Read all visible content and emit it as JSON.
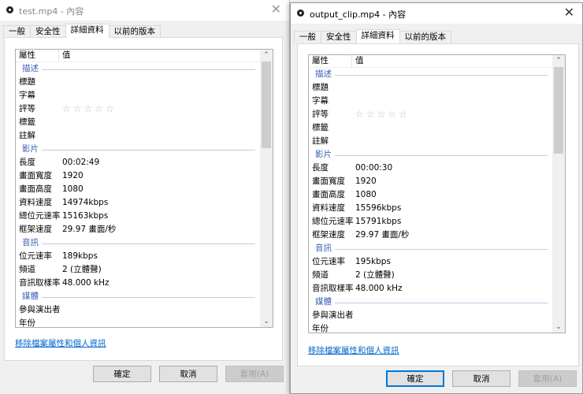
{
  "dialogs": [
    {
      "title": "test.mp4 - 內容",
      "tabs": [
        "一般",
        "安全性",
        "詳細資料",
        "以前的版本"
      ],
      "active_tab": 2,
      "header": {
        "property": "屬性",
        "value": "值"
      },
      "rows": [
        {
          "group": "描述"
        },
        {
          "k": "標題",
          "v": ""
        },
        {
          "k": "字幕",
          "v": ""
        },
        {
          "k": "評等",
          "stars": "☆☆☆☆☆"
        },
        {
          "k": "標籤",
          "v": ""
        },
        {
          "k": "註解",
          "v": ""
        },
        {
          "group": "影片"
        },
        {
          "k": "長度",
          "v": "00:02:49"
        },
        {
          "k": "畫面寬度",
          "v": "1920"
        },
        {
          "k": "畫面高度",
          "v": "1080"
        },
        {
          "k": "資料速度",
          "v": "14974kbps"
        },
        {
          "k": "總位元速率",
          "v": "15163kbps"
        },
        {
          "k": "框架速度",
          "v": "29.97 畫面/秒"
        },
        {
          "group": "音訊"
        },
        {
          "k": "位元速率",
          "v": "189kbps"
        },
        {
          "k": "頻道",
          "v": "2 (立體聲)"
        },
        {
          "k": "音訊取樣率",
          "v": "48.000 kHz"
        },
        {
          "group": "媒體"
        },
        {
          "k": "參與演出者",
          "v": ""
        },
        {
          "k": "年份",
          "v": ""
        }
      ],
      "link": "移除檔案屬性和個人資訊",
      "buttons": {
        "ok": "確定",
        "cancel": "取消",
        "apply": "套用(A)"
      }
    },
    {
      "title": "output_clip.mp4 - 內容",
      "tabs": [
        "一般",
        "安全性",
        "詳細資料",
        "以前的版本"
      ],
      "active_tab": 2,
      "header": {
        "property": "屬性",
        "value": "值"
      },
      "rows": [
        {
          "group": "描述"
        },
        {
          "k": "標題",
          "v": ""
        },
        {
          "k": "字幕",
          "v": ""
        },
        {
          "k": "評等",
          "stars": "☆☆☆☆☆"
        },
        {
          "k": "標籤",
          "v": ""
        },
        {
          "k": "註解",
          "v": ""
        },
        {
          "group": "影片"
        },
        {
          "k": "長度",
          "v": "00:00:30"
        },
        {
          "k": "畫面寬度",
          "v": "1920"
        },
        {
          "k": "畫面高度",
          "v": "1080"
        },
        {
          "k": "資料速度",
          "v": "15596kbps"
        },
        {
          "k": "總位元速率",
          "v": "15791kbps"
        },
        {
          "k": "框架速度",
          "v": "29.97 畫面/秒"
        },
        {
          "group": "音訊"
        },
        {
          "k": "位元速率",
          "v": "195kbps"
        },
        {
          "k": "頻道",
          "v": "2 (立體聲)"
        },
        {
          "k": "音訊取樣率",
          "v": "48.000 kHz"
        },
        {
          "group": "媒體"
        },
        {
          "k": "參與演出者",
          "v": ""
        },
        {
          "k": "年份",
          "v": ""
        }
      ],
      "link": "移除檔案屬性和個人資訊",
      "buttons": {
        "ok": "確定",
        "cancel": "取消",
        "apply": "套用(A)"
      }
    }
  ]
}
